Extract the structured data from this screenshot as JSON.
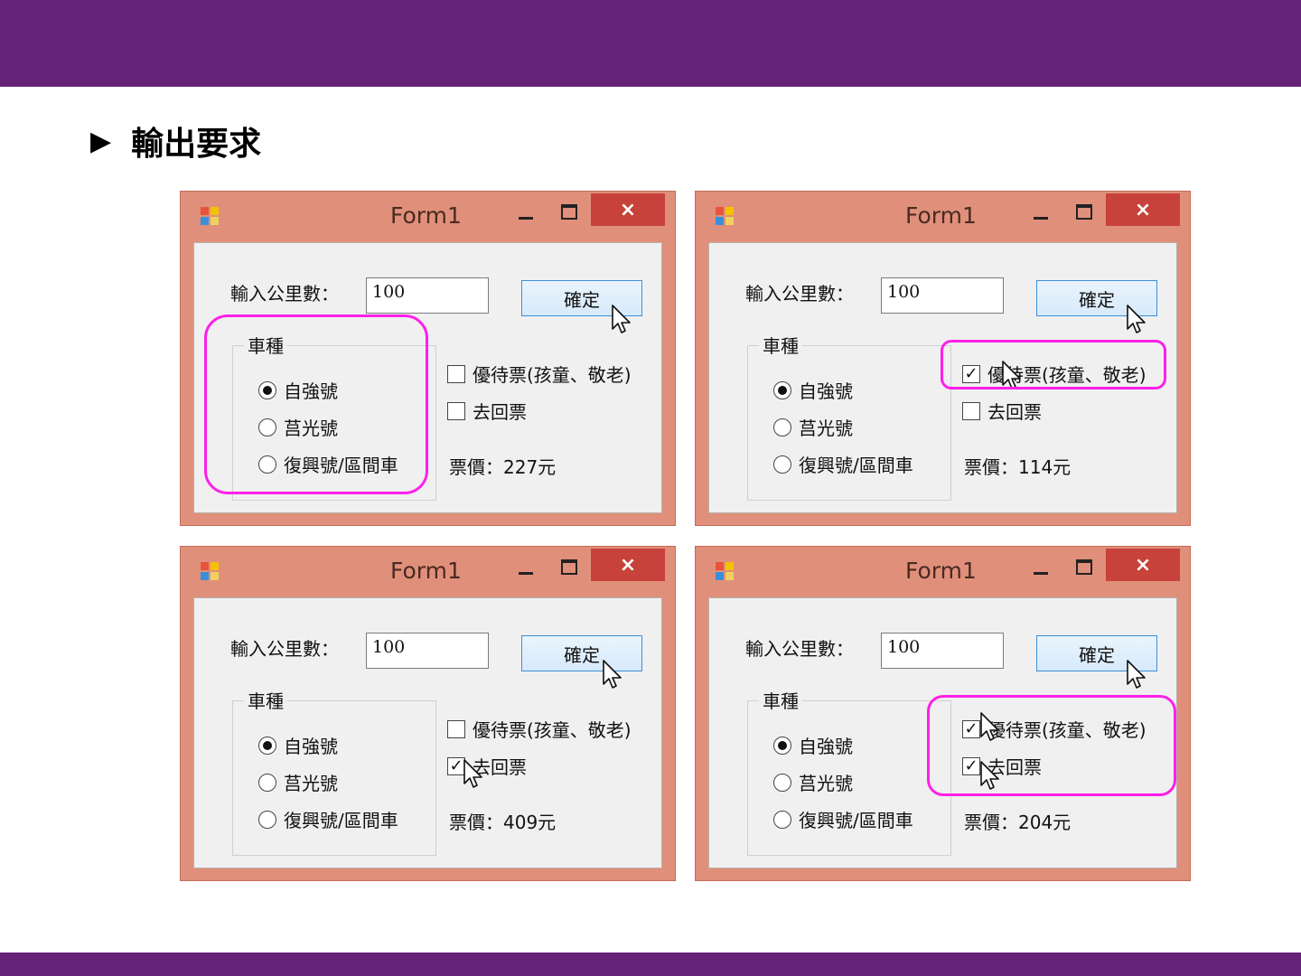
{
  "slide": {
    "bullet": "▶",
    "heading": "輸出要求"
  },
  "colors": {
    "band": "#662276",
    "window_frame": "#e0907a",
    "close_button": "#c7423a",
    "highlight": "#ff1fea"
  },
  "icons": {
    "app": "app-icon",
    "minimize": "minimize-icon",
    "maximize": "maximize-icon",
    "close": "close-icon",
    "cursor": "mouse-pointer-icon"
  },
  "windows": [
    {
      "title": "Form1",
      "close_glyph": "×",
      "km_label": "輸入公里數：",
      "km_value": "100",
      "ok_label": "確定",
      "group_label": "車種",
      "radios": [
        {
          "label": "自強號",
          "selected": true
        },
        {
          "label": "莒光號",
          "selected": false
        },
        {
          "label": "復興號/區間車",
          "selected": false
        }
      ],
      "checks": [
        {
          "label": "優待票(孩童、敬老)",
          "checked": false
        },
        {
          "label": "去回票",
          "checked": false
        }
      ],
      "price": "票價：227元"
    },
    {
      "title": "Form1",
      "close_glyph": "×",
      "km_label": "輸入公里數：",
      "km_value": "100",
      "ok_label": "確定",
      "group_label": "車種",
      "radios": [
        {
          "label": "自強號",
          "selected": true
        },
        {
          "label": "莒光號",
          "selected": false
        },
        {
          "label": "復興號/區間車",
          "selected": false
        }
      ],
      "checks": [
        {
          "label": "優待票(孩童、敬老)",
          "checked": true
        },
        {
          "label": "去回票",
          "checked": false
        }
      ],
      "price": "票價：114元"
    },
    {
      "title": "Form1",
      "close_glyph": "×",
      "km_label": "輸入公里數：",
      "km_value": "100",
      "ok_label": "確定",
      "group_label": "車種",
      "radios": [
        {
          "label": "自強號",
          "selected": true
        },
        {
          "label": "莒光號",
          "selected": false
        },
        {
          "label": "復興號/區間車",
          "selected": false
        }
      ],
      "checks": [
        {
          "label": "優待票(孩童、敬老)",
          "checked": false
        },
        {
          "label": "去回票",
          "checked": true
        }
      ],
      "price": "票價：409元"
    },
    {
      "title": "Form1",
      "close_glyph": "×",
      "km_label": "輸入公里數：",
      "km_value": "100",
      "ok_label": "確定",
      "group_label": "車種",
      "radios": [
        {
          "label": "自強號",
          "selected": true
        },
        {
          "label": "莒光號",
          "selected": false
        },
        {
          "label": "復興號/區間車",
          "selected": false
        }
      ],
      "checks": [
        {
          "label": "優待票(孩童、敬老)",
          "checked": true
        },
        {
          "label": "去回票",
          "checked": true
        }
      ],
      "price": "票價：204元"
    }
  ]
}
